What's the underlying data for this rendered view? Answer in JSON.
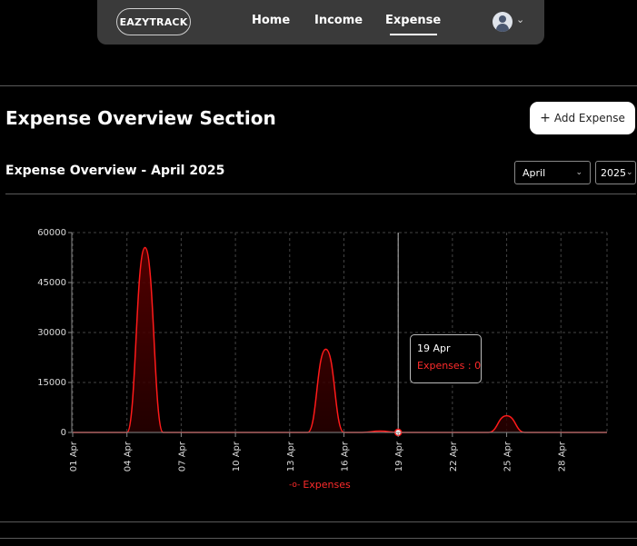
{
  "nav": {
    "brand": "EAZYTRACK",
    "links": [
      {
        "label": "Home",
        "active": false
      },
      {
        "label": "Income",
        "active": false
      },
      {
        "label": "Expense",
        "active": true
      }
    ],
    "avatar_icon": "user-avatar-icon"
  },
  "page": {
    "title": "Expense Overview Section",
    "add_button": "Add Expense",
    "add_button_icon": "plus-icon"
  },
  "overview": {
    "title": "Expense Overview - April 2025",
    "month_select": "April",
    "year_select": "2025"
  },
  "tooltip": {
    "date": "19 Apr",
    "label": "Expenses : ",
    "value": "0"
  },
  "legend": {
    "label": "Expenses"
  },
  "colors": {
    "accent": "#ff1a1a",
    "background": "#000000",
    "navbar": "#3a3a3a"
  },
  "chart_data": {
    "type": "area",
    "title": "",
    "xlabel": "",
    "ylabel": "",
    "ylim": [
      0,
      60000
    ],
    "yticks": [
      0,
      15000,
      30000,
      45000,
      60000
    ],
    "xticks": [
      "01 Apr",
      "04 Apr",
      "07 Apr",
      "10 Apr",
      "13 Apr",
      "16 Apr",
      "19 Apr",
      "22 Apr",
      "25 Apr",
      "28 Apr"
    ],
    "grid": true,
    "legend": "bottom-center",
    "series": [
      {
        "name": "Expenses",
        "x": [
          "01 Apr",
          "02 Apr",
          "03 Apr",
          "04 Apr",
          "05 Apr",
          "06 Apr",
          "07 Apr",
          "08 Apr",
          "09 Apr",
          "10 Apr",
          "11 Apr",
          "12 Apr",
          "13 Apr",
          "14 Apr",
          "15 Apr",
          "16 Apr",
          "17 Apr",
          "18 Apr",
          "19 Apr",
          "20 Apr",
          "21 Apr",
          "22 Apr",
          "23 Apr",
          "24 Apr",
          "25 Apr",
          "26 Apr",
          "27 Apr",
          "28 Apr",
          "29 Apr",
          "30 Apr"
        ],
        "values": [
          0,
          0,
          0,
          0,
          55500,
          0,
          0,
          0,
          0,
          0,
          0,
          0,
          0,
          0,
          25000,
          0,
          0,
          400,
          0,
          0,
          0,
          0,
          0,
          0,
          5000,
          0,
          0,
          0,
          0,
          0
        ]
      }
    ]
  }
}
